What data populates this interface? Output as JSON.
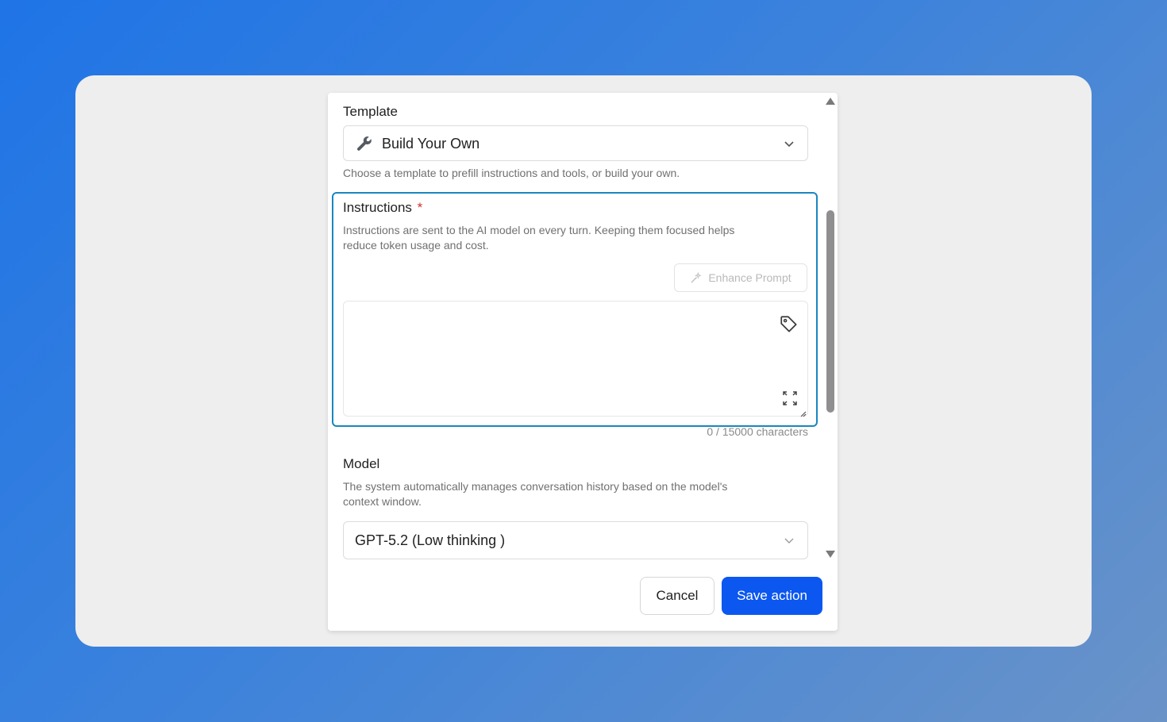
{
  "template": {
    "label": "Template",
    "selected": "Build Your Own",
    "selected_icon": "wrench-icon",
    "help": "Choose a template to prefill instructions and tools, or build your own."
  },
  "instructions": {
    "label": "Instructions",
    "required_marker": "*",
    "help_line1": "Instructions are sent to the AI model on every turn. Keeping them focused helps",
    "help_line2": "reduce token usage and cost.",
    "enhance_label": "Enhance Prompt",
    "value": "",
    "counter": "0 / 15000 characters"
  },
  "model": {
    "label": "Model",
    "help_line1": "The system automatically manages conversation history based on the model's",
    "help_line2": "context window.",
    "selected": "GPT-5.2 (Low thinking )"
  },
  "actions": {
    "cancel_label": "Cancel",
    "save_label": "Save action"
  },
  "colors": {
    "accent": "#0b57f0",
    "focus_border": "#1a86c0",
    "required": "#d32f2f"
  }
}
